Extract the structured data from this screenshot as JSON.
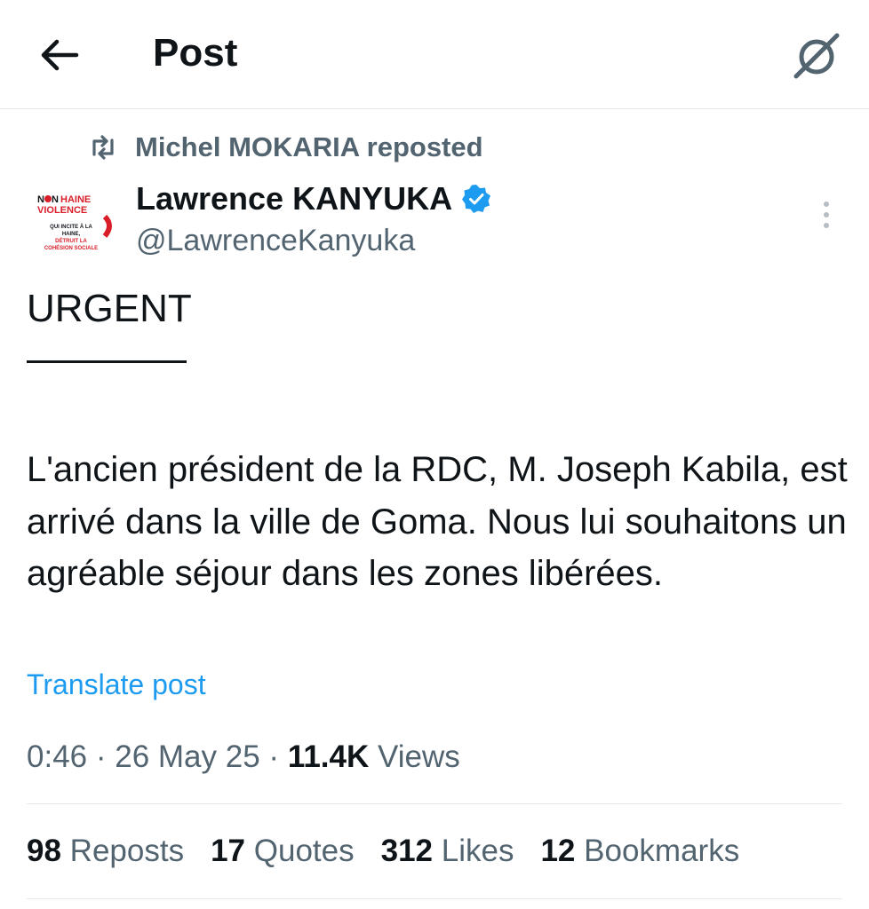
{
  "header": {
    "title": "Post",
    "back_icon": "arrow-left-icon",
    "grok_icon": "grok-icon"
  },
  "repost": {
    "text": "Michel MOKARIA reposted",
    "icon": "repost-icon"
  },
  "author": {
    "name": "Lawrence KANYUKA",
    "handle": "@LawrenceKanyuka",
    "verified": true,
    "avatar_text": {
      "line1_a": "N",
      "line1_b": "N",
      "line1_c": "HAINE",
      "line2": "VIOLENCE",
      "line3": "QUI INCITE À LA",
      "line4": "HAINE,",
      "line5": "DÉTRUIT LA",
      "line6": "COHÉSION SOCIALE"
    }
  },
  "post": {
    "headline": "URGENT",
    "body": "L'ancien président de la RDC, M. Joseph Kabila, est arrivé dans la ville de Goma. Nous lui souhaitons un agréable séjour dans les zones libérées.",
    "translate_label": "Translate post"
  },
  "meta": {
    "time": "0:46",
    "sep": "·",
    "date": "26 May 25",
    "views_count": "11.4K",
    "views_label": "Views"
  },
  "stats": [
    {
      "count": "98",
      "label": "Reposts"
    },
    {
      "count": "17",
      "label": "Quotes"
    },
    {
      "count": "312",
      "label": "Likes"
    },
    {
      "count": "12",
      "label": "Bookmarks"
    }
  ],
  "colors": {
    "link": "#1d9bf0",
    "muted": "#536471",
    "text": "#0f1419",
    "divider": "#e6e9ec",
    "badge": "#1d9bf0",
    "avatar_red": "#d91e2a"
  }
}
